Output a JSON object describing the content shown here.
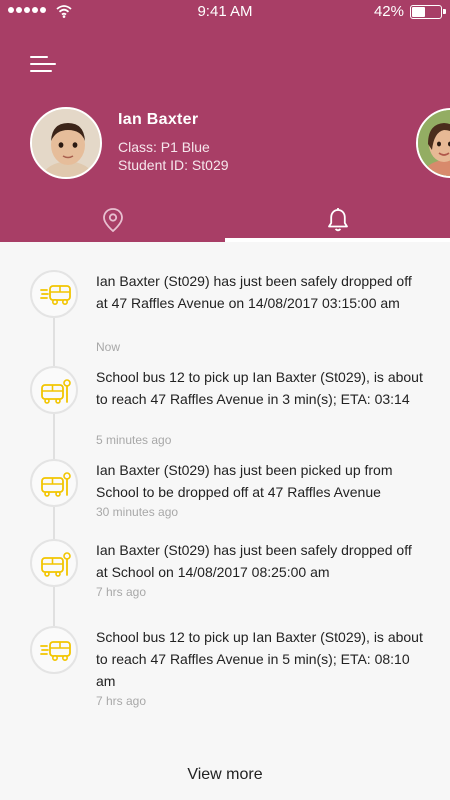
{
  "status_bar": {
    "time": "9:41 AM",
    "battery_percent": "42%",
    "battery_level": 0.42
  },
  "header": {
    "background_color": "#a83e66",
    "menu_icon": "hamburger-menu-icon"
  },
  "student": {
    "name": "Ian Baxter",
    "class": "Class: P1 Blue",
    "student_id": "Student ID: St029"
  },
  "tabs": [
    {
      "icon": "location-pin-icon",
      "active": false
    },
    {
      "icon": "bell-icon",
      "active": true
    }
  ],
  "notifications": [
    {
      "icon": "bus-moving-icon",
      "text": "Ian Baxter (St029) has just been safely dropped off at 47 Raffles Avenue on 14/08/2017 03:15:00 am",
      "time": "Now"
    },
    {
      "icon": "bus-stop-icon",
      "text": "School bus 12 to pick up Ian Baxter (St029), is about to reach 47 Raffles Avenue in 3 min(s); ETA: 03:14",
      "time": "5 minutes ago"
    },
    {
      "icon": "bus-stop-icon",
      "text": "Ian Baxter (St029) has just been picked up from School to be dropped off at 47 Raffles Avenue",
      "time": "30 minutes ago"
    },
    {
      "icon": "bus-stop-icon",
      "text": "Ian Baxter (St029) has just been safely dropped off at School on 14/08/2017 08:25:00 am",
      "time": "7 hrs ago"
    },
    {
      "icon": "bus-moving-icon",
      "text": "School bus 12 to pick up Ian Baxter (St029), is about to reach 47 Raffles Avenue in 5 min(s); ETA: 08:10 am",
      "time": "7 hrs ago"
    }
  ],
  "view_more_label": "View more",
  "colors": {
    "accent": "#a83e66",
    "bus_icon": "#f2c500",
    "muted_text": "#a8a8a8"
  }
}
